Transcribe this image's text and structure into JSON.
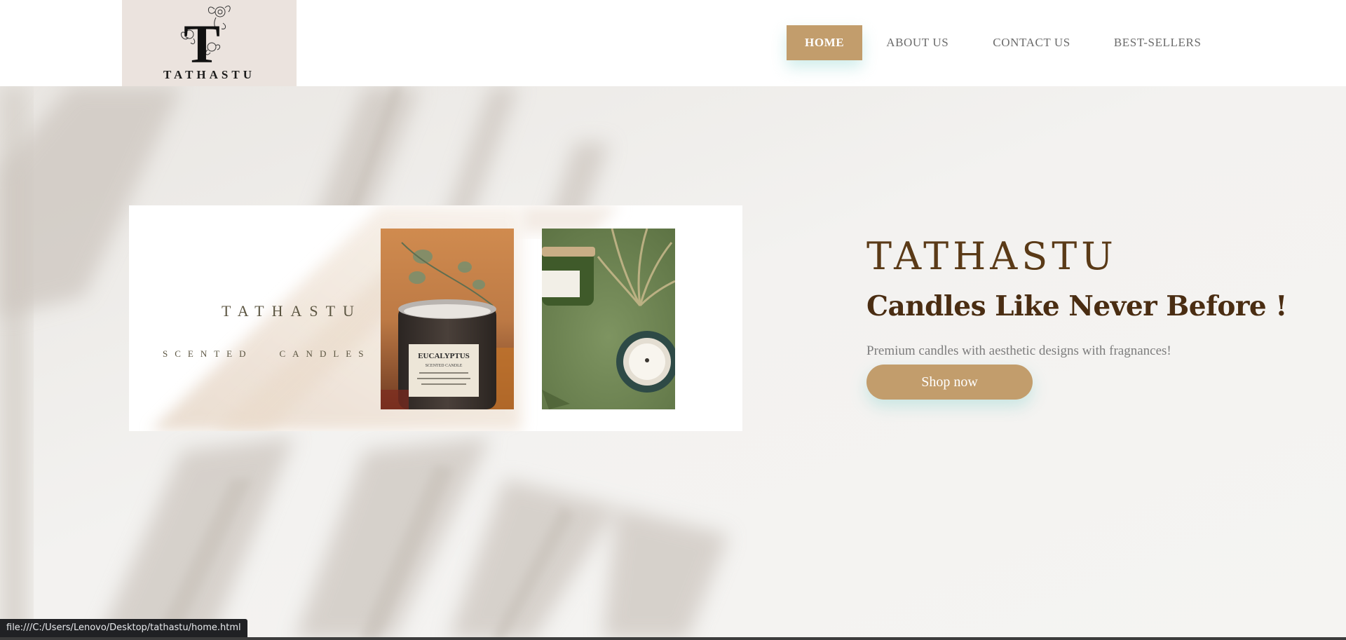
{
  "header": {
    "logo_letter": "T",
    "logo_text": "TATHASTU",
    "nav": {
      "home": "HOME",
      "about": "ABOUT US",
      "contact": "CONTACT US",
      "best_sellers": "BEST-SELLERS"
    },
    "active_nav": "HOME"
  },
  "banner": {
    "title": "TATHASTU",
    "subtitle_word1": "SCENTED",
    "subtitle_word2": "CANDLES",
    "photo1_label_top": "EUCALYPTUS",
    "photo1_label_sub": "SCENTED CANDLE"
  },
  "hero": {
    "brand": "TATHASTU",
    "tagline": "Candles Like Never Before !",
    "description": "Premium candles with aesthetic designs with fragnances!",
    "button_label": "Shop now"
  },
  "status_bar": {
    "url": "file:///C:/Users/Lenovo/Desktop/tathastu/home.html"
  },
  "colors": {
    "accent": "#c29d6c",
    "brand_text": "#5a3a17",
    "logo_bg": "#ebe3de",
    "background": "#f2f1ef"
  },
  "icons": [
    "logo-floral-icon"
  ]
}
